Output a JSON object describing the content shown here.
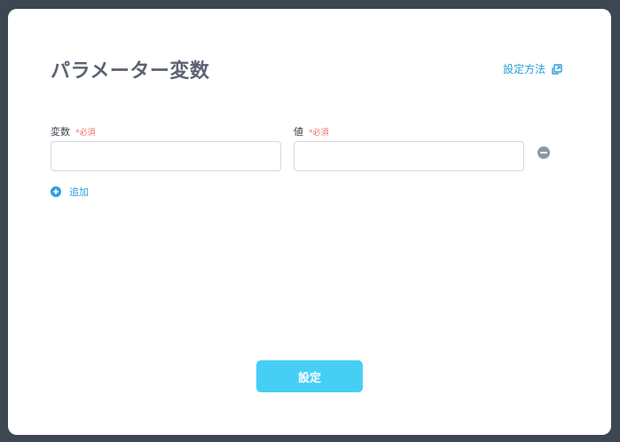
{
  "dialog": {
    "title": "パラメーター変数",
    "help_link": "設定方法"
  },
  "form": {
    "variable_label": "変数",
    "value_label": "値",
    "required_text": "*必須",
    "variable_value": "",
    "value_value": "",
    "add_label": "追加",
    "submit_label": "設定"
  },
  "icons": {
    "help": "external-link-icon",
    "remove": "minus-circle-icon",
    "add": "plus-circle-icon"
  },
  "colors": {
    "backdrop": "#3d4752",
    "accent": "#2a9fd6",
    "submit": "#46cff5",
    "required": "#ef6b6b"
  }
}
